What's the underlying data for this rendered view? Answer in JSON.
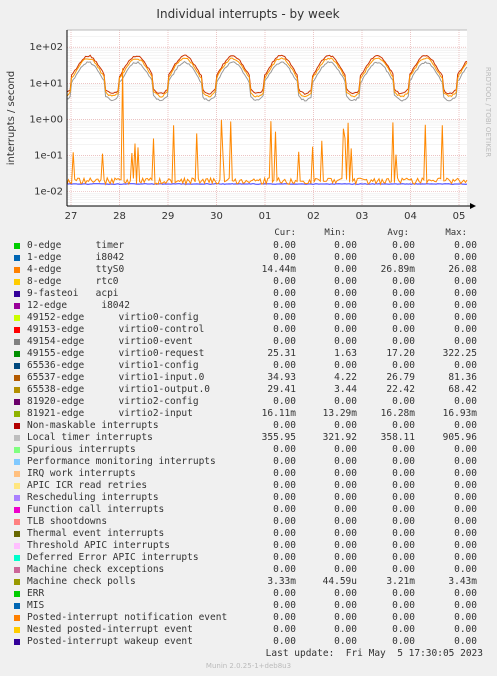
{
  "chart_data": {
    "type": "line",
    "title": "Individual interrupts - by week",
    "ylabel": "interrupts / second",
    "yscale": "log",
    "ylim": [
      0.004,
      300
    ],
    "yticks": [
      "1e-02",
      "1e-01",
      "1e+00",
      "1e+01",
      "1e+02"
    ],
    "xticks": [
      "27",
      "28",
      "29",
      "30",
      "01",
      "02",
      "03",
      "04",
      "05"
    ],
    "grid": true,
    "series": [
      {
        "name": "Local timer interrupts",
        "color": "#bbbbbb",
        "shape": "flat",
        "level": 330
      },
      {
        "name": "virtio0-request",
        "color": "#999999",
        "shape": "daily",
        "level": 17
      },
      {
        "name": "virtio1-input.0",
        "color": "#cc3300",
        "shape": "daily",
        "level": 26
      },
      {
        "name": "virtio1-output.0",
        "color": "#ff9900",
        "shape": "daily",
        "level": 22
      },
      {
        "name": "virtio2-input",
        "color": "#3333ff",
        "shape": "flat",
        "level": 0.0163
      },
      {
        "name": "ttyS0",
        "color": "#ff8800",
        "shape": "spiky",
        "level": 0.02
      },
      {
        "name": "Machine check polls",
        "color": "#999900",
        "shape": "flat",
        "level": 0.0032
      }
    ]
  },
  "side_text": "RRDTOOL / TOBI OETIKER",
  "legend": {
    "head": {
      "cur": "Cur:",
      "min": "Min:",
      "avg": "Avg:",
      "max": "Max:"
    },
    "rows": [
      {
        "color": "#00cc00",
        "name": "0-edge      timer",
        "cur": "0.00",
        "min": "0.00",
        "avg": "0.00",
        "max": "0.00"
      },
      {
        "color": "#0066b3",
        "name": "1-edge      i8042",
        "cur": "0.00",
        "min": "0.00",
        "avg": "0.00",
        "max": "0.00"
      },
      {
        "color": "#ff8000",
        "name": "4-edge      ttyS0",
        "cur": "14.44m",
        "min": "0.00",
        "avg": "26.89m",
        "max": "26.08"
      },
      {
        "color": "#ffcc00",
        "name": "8-edge      rtc0",
        "cur": "0.00",
        "min": "0.00",
        "avg": "0.00",
        "max": "0.00"
      },
      {
        "color": "#330099",
        "name": "9-fasteoi   acpi",
        "cur": "0.00",
        "min": "0.00",
        "avg": "0.00",
        "max": "0.00"
      },
      {
        "color": "#990099",
        "name": "12-edge      i8042",
        "cur": "0.00",
        "min": "0.00",
        "avg": "0.00",
        "max": "0.00"
      },
      {
        "color": "#ccff00",
        "name": "49152-edge      virtio0-config",
        "cur": "0.00",
        "min": "0.00",
        "avg": "0.00",
        "max": "0.00"
      },
      {
        "color": "#ff0000",
        "name": "49153-edge      virtio0-control",
        "cur": "0.00",
        "min": "0.00",
        "avg": "0.00",
        "max": "0.00"
      },
      {
        "color": "#808080",
        "name": "49154-edge      virtio0-event",
        "cur": "0.00",
        "min": "0.00",
        "avg": "0.00",
        "max": "0.00"
      },
      {
        "color": "#008f00",
        "name": "49155-edge      virtio0-request",
        "cur": "25.31",
        "min": "1.63",
        "avg": "17.20",
        "max": "322.25"
      },
      {
        "color": "#00487d",
        "name": "65536-edge      virtio1-config",
        "cur": "0.00",
        "min": "0.00",
        "avg": "0.00",
        "max": "0.00"
      },
      {
        "color": "#b35a00",
        "name": "65537-edge      virtio1-input.0",
        "cur": "34.93",
        "min": "4.22",
        "avg": "26.79",
        "max": "81.36"
      },
      {
        "color": "#b38f00",
        "name": "65538-edge      virtio1-output.0",
        "cur": "29.41",
        "min": "3.44",
        "avg": "22.42",
        "max": "68.42"
      },
      {
        "color": "#6b006b",
        "name": "81920-edge      virtio2-config",
        "cur": "0.00",
        "min": "0.00",
        "avg": "0.00",
        "max": "0.00"
      },
      {
        "color": "#8fb300",
        "name": "81921-edge      virtio2-input",
        "cur": "16.11m",
        "min": "13.29m",
        "avg": "16.28m",
        "max": "16.93m"
      },
      {
        "color": "#b30000",
        "name": "Non-maskable interrupts",
        "cur": "0.00",
        "min": "0.00",
        "avg": "0.00",
        "max": "0.00"
      },
      {
        "color": "#bebebe",
        "name": "Local timer interrupts",
        "cur": "355.95",
        "min": "321.92",
        "avg": "358.11",
        "max": "905.96"
      },
      {
        "color": "#80ff80",
        "name": "Spurious interrupts",
        "cur": "0.00",
        "min": "0.00",
        "avg": "0.00",
        "max": "0.00"
      },
      {
        "color": "#80c9ff",
        "name": "Performance monitoring interrupts",
        "cur": "0.00",
        "min": "0.00",
        "avg": "0.00",
        "max": "0.00"
      },
      {
        "color": "#ffc080",
        "name": "IRQ work interrupts",
        "cur": "0.00",
        "min": "0.00",
        "avg": "0.00",
        "max": "0.00"
      },
      {
        "color": "#ffe680",
        "name": "APIC ICR read retries",
        "cur": "0.00",
        "min": "0.00",
        "avg": "0.00",
        "max": "0.00"
      },
      {
        "color": "#aa80ff",
        "name": "Rescheduling interrupts",
        "cur": "0.00",
        "min": "0.00",
        "avg": "0.00",
        "max": "0.00"
      },
      {
        "color": "#ee00cc",
        "name": "Function call interrupts",
        "cur": "0.00",
        "min": "0.00",
        "avg": "0.00",
        "max": "0.00"
      },
      {
        "color": "#ff8080",
        "name": "TLB shootdowns",
        "cur": "0.00",
        "min": "0.00",
        "avg": "0.00",
        "max": "0.00"
      },
      {
        "color": "#666600",
        "name": "Thermal event interrupts",
        "cur": "0.00",
        "min": "0.00",
        "avg": "0.00",
        "max": "0.00"
      },
      {
        "color": "#ffbfff",
        "name": "Threshold APIC interrupts",
        "cur": "0.00",
        "min": "0.00",
        "avg": "0.00",
        "max": "0.00"
      },
      {
        "color": "#00ffcc",
        "name": "Deferred Error APIC interrupts",
        "cur": "0.00",
        "min": "0.00",
        "avg": "0.00",
        "max": "0.00"
      },
      {
        "color": "#cc6699",
        "name": "Machine check exceptions",
        "cur": "0.00",
        "min": "0.00",
        "avg": "0.00",
        "max": "0.00"
      },
      {
        "color": "#999900",
        "name": "Machine check polls",
        "cur": "3.33m",
        "min": "44.59u",
        "avg": "3.21m",
        "max": "3.43m"
      },
      {
        "color": "#00cc00",
        "name": "ERR",
        "cur": "0.00",
        "min": "0.00",
        "avg": "0.00",
        "max": "0.00"
      },
      {
        "color": "#0066b3",
        "name": "MIS",
        "cur": "0.00",
        "min": "0.00",
        "avg": "0.00",
        "max": "0.00"
      },
      {
        "color": "#ff8000",
        "name": "Posted-interrupt notification event",
        "cur": "0.00",
        "min": "0.00",
        "avg": "0.00",
        "max": "0.00"
      },
      {
        "color": "#ffcc00",
        "name": "Nested posted-interrupt event",
        "cur": "0.00",
        "min": "0.00",
        "avg": "0.00",
        "max": "0.00"
      },
      {
        "color": "#330099",
        "name": "Posted-interrupt wakeup event",
        "cur": "0.00",
        "min": "0.00",
        "avg": "0.00",
        "max": "0.00"
      }
    ]
  },
  "footer": {
    "last_update": "Last update:  Fri May  5 17:30:05 2023",
    "munin": "Munin 2.0.25-1+deb8u3"
  }
}
